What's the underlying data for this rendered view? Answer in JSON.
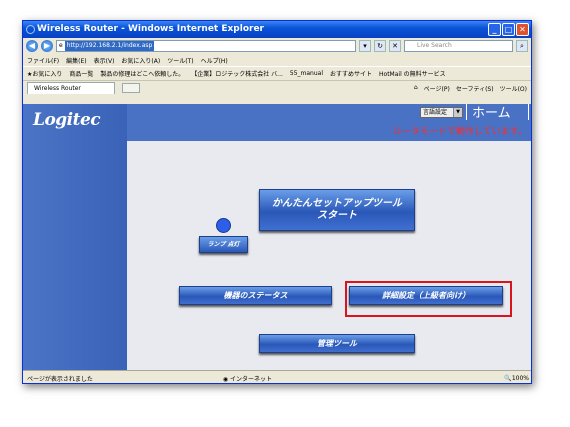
{
  "window": {
    "title": "Wireless Router - Windows Internet Explorer"
  },
  "address": {
    "url": "http://192.168.2.1/index.asp",
    "search_placeholder": "Live Search"
  },
  "menu": [
    "ファイル(F)",
    "編集(E)",
    "表示(V)",
    "お気に入り(A)",
    "ツール(T)",
    "ヘルプ(H)"
  ],
  "favorites": {
    "label": "お気に入り",
    "items": [
      "商品一覧",
      "製品の修理はどこへ依頼した。",
      "【企業】ロジテック株式会社 バ...",
      "55_manual",
      "おすすめサイト",
      "HotMail の無料サービス"
    ]
  },
  "tab": {
    "label": "Wireless Router",
    "tools": [
      "ページ(P)",
      "セーフティ(S)",
      "ツール(O)"
    ]
  },
  "page": {
    "logo": "Logitec",
    "lang": "言語設定",
    "home": "ホーム",
    "mode": "ルータモードで動作しています。",
    "setup": "かんたんセットアップツール\nスタート",
    "lamp": "ランプ 点灯",
    "status": "機器のステータス",
    "advanced": "詳細設定（上級者向け）",
    "admin": "管理ツール"
  },
  "statusbar": {
    "left": "ページが表示されました",
    "zone": "インターネット",
    "zoom": "100%"
  }
}
